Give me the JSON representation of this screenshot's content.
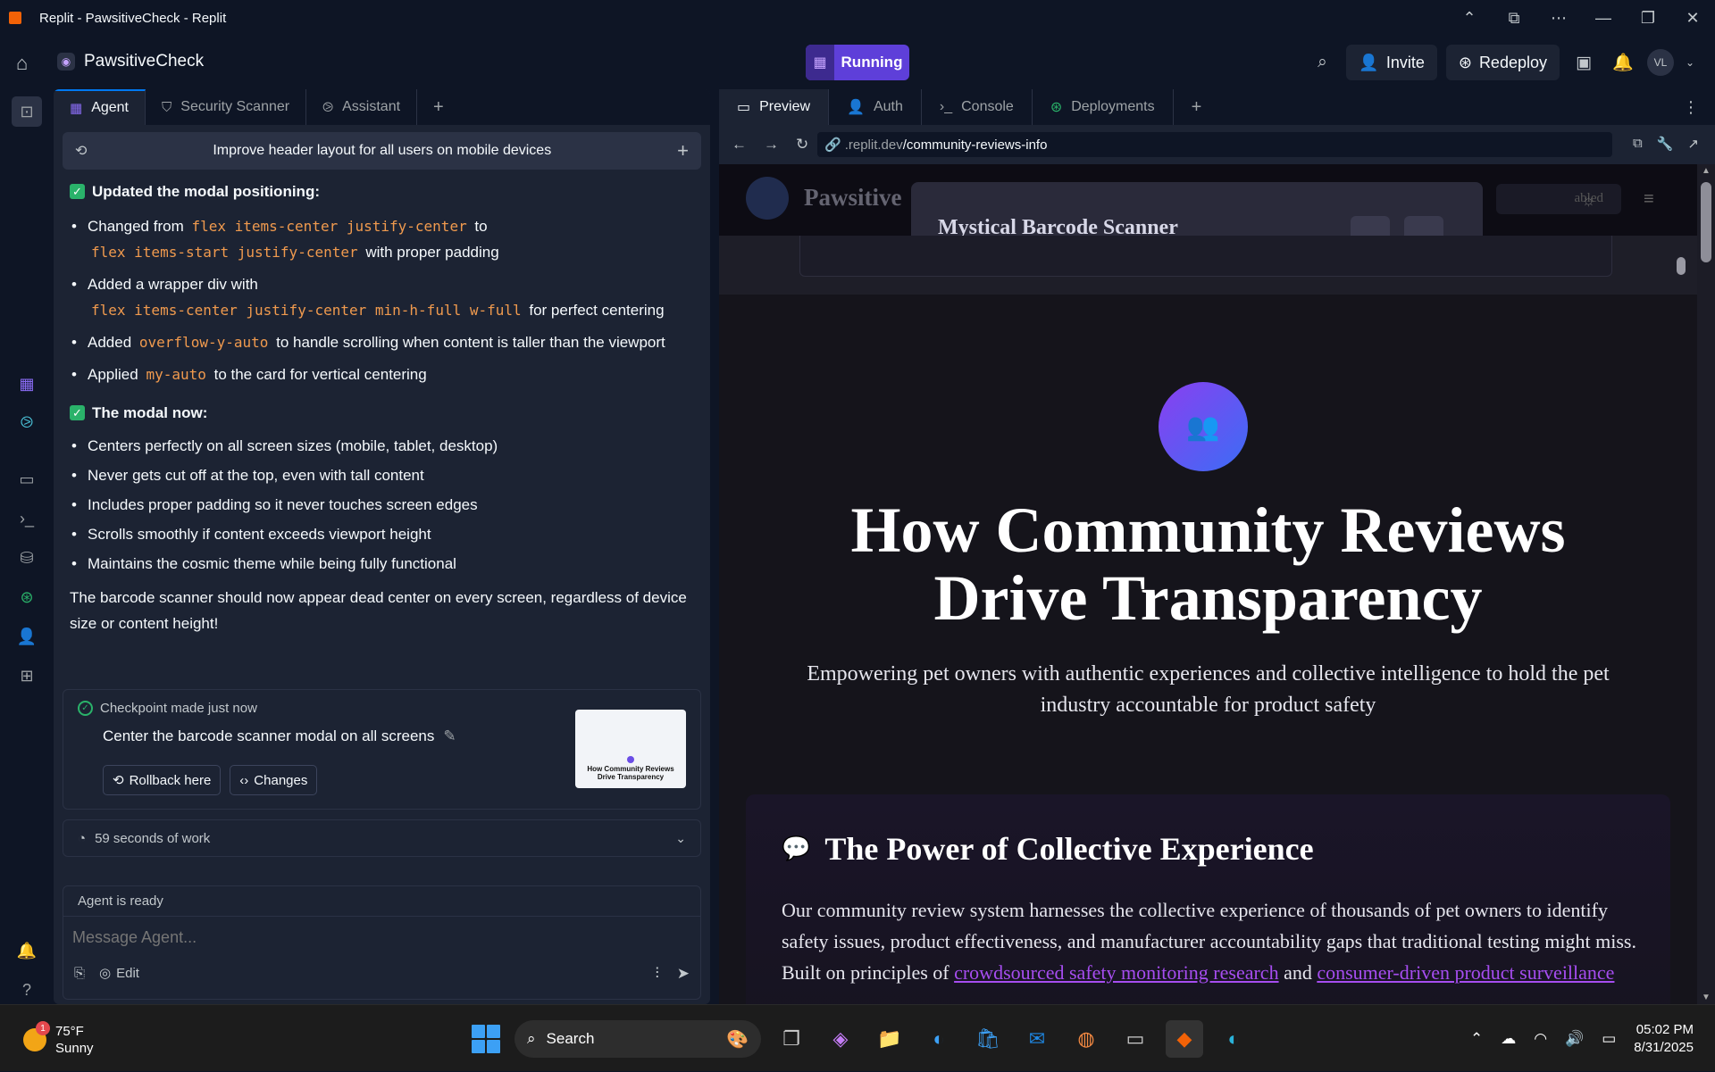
{
  "window": {
    "title": "Replit - PawsitiveCheck - Replit"
  },
  "topbar": {
    "project_name": "PawsitiveCheck",
    "run_label": "Running",
    "invite_label": "Invite",
    "redeploy_label": "Redeploy",
    "avatar_initials": "VL"
  },
  "left_tabs": [
    {
      "label": "Agent"
    },
    {
      "label": "Security Scanner"
    },
    {
      "label": "Assistant"
    }
  ],
  "agent": {
    "improve_prompt": "Improve header layout for all users on mobile devices",
    "section1_title": "Updated the modal positioning:",
    "s1_items": [
      {
        "pre": "Changed from ",
        "code1": "flex items-center justify-center",
        "mid": " to",
        "code2": "flex items-start justify-center",
        "post": " with proper padding"
      },
      {
        "pre": "Added a wrapper div with",
        "code1": "flex items-center justify-center min-h-full w-full",
        "post": " for perfect centering"
      },
      {
        "pre": "Added ",
        "code1": "overflow-y-auto",
        "post": " to handle scrolling when content is taller than the viewport"
      },
      {
        "pre": "Applied ",
        "code1": "my-auto",
        "post": " to the card for vertical centering"
      }
    ],
    "section2_title": "The modal now:",
    "s2_items": [
      "Centers perfectly on all screen sizes (mobile, tablet, desktop)",
      "Never gets cut off at the top, even with tall content",
      "Includes proper padding so it never touches screen edges",
      "Scrolls smoothly if content exceeds viewport height",
      "Maintains the cosmic theme while being fully functional"
    ],
    "closing": "The barcode scanner should now appear dead center on every screen, regardless of device size or content height!",
    "checkpoint": {
      "header": "Checkpoint made just now",
      "title": "Center the barcode scanner modal on all screens",
      "rollback_label": "Rollback here",
      "changes_label": "Changes",
      "thumb_title": "How Community Reviews Drive Transparency"
    },
    "work_summary": "59 seconds of work",
    "input_status": "Agent is ready",
    "input_placeholder": "Message Agent...",
    "edit_label": "Edit"
  },
  "right_tabs": [
    {
      "label": "Preview"
    },
    {
      "label": "Auth"
    },
    {
      "label": "Console"
    },
    {
      "label": "Deployments"
    }
  ],
  "preview": {
    "url_domain": ".replit.dev",
    "url_path": "/community-reviews-info",
    "site_name": "Pawsitive",
    "modal_title": "Mystical Barcode Scanner",
    "badge_text": "abled",
    "hero_title_line1": "How Community Reviews",
    "hero_title_line2": "Drive Transparency",
    "hero_subtitle": "Empowering pet owners with authentic experiences and collective intelligence to hold the pet industry accountable for product safety",
    "card_title": "The Power of Collective Experience",
    "card_text_pre": "Our community review system harnesses the collective experience of thousands of pet owners to identify safety issues, product effectiveness, and manufacturer accountability gaps that traditional testing might miss. Built on principles of ",
    "card_link1": "crowdsourced safety monitoring research",
    "card_text_mid": " and ",
    "card_link2": "consumer-driven product surveillance",
    "accent_color": "#a64df0"
  },
  "taskbar": {
    "weather_temp": "75°F",
    "weather_desc": "Sunny",
    "weather_badge": "1",
    "search_label": "Search",
    "time": "05:02 PM",
    "date": "8/31/2025"
  }
}
